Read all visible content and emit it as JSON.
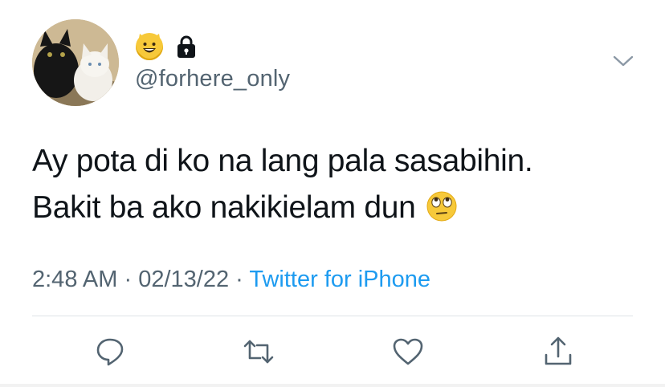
{
  "user": {
    "handle": "@forhere_only",
    "display_name_icons": [
      "grinning-cat-emoji",
      "lock-icon"
    ]
  },
  "tweet": {
    "lines": [
      "Ay pota di ko na lang pala sasabihin.",
      "Bakit ba ako nakikielam dun"
    ],
    "trailing_emoji": "face-with-rolling-eyes-emoji"
  },
  "meta": {
    "time": "2:48 AM",
    "separator": "·",
    "date": "02/13/22",
    "source": "Twitter for iPhone"
  },
  "actions": [
    "reply-icon",
    "retweet-icon",
    "like-icon",
    "share-icon"
  ],
  "colors": {
    "text": "#0f1419",
    "secondary": "#536471",
    "link": "#1d9bf0"
  }
}
